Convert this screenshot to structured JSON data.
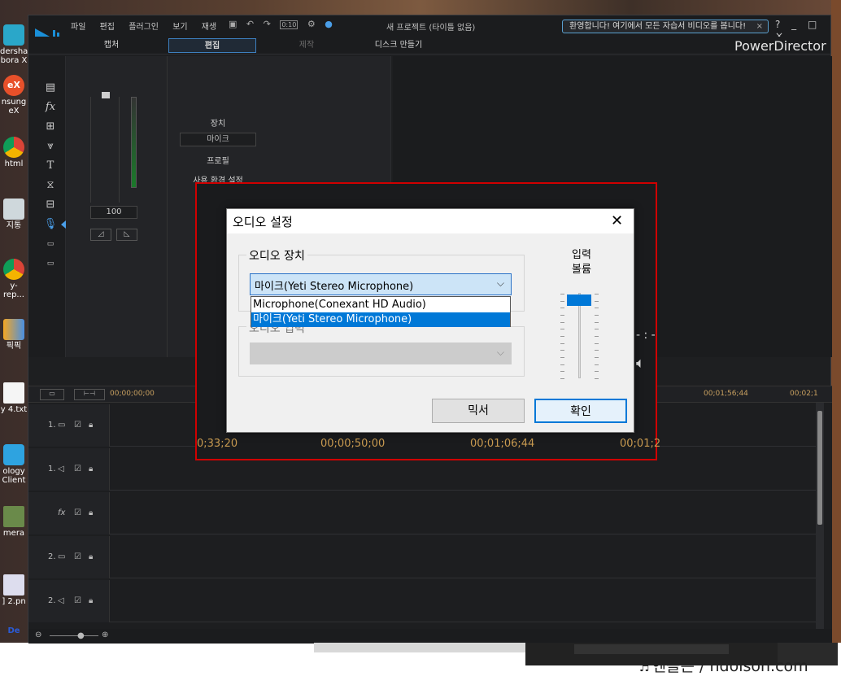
{
  "desktop": {
    "icons": [
      {
        "label": "dershare\nbora X"
      },
      {
        "label": "nsung\neX"
      },
      {
        "label": "html"
      },
      {
        "label": "지통"
      },
      {
        "label": "y-rep..."
      },
      {
        "label": "픽픽"
      },
      {
        "label": "y 4.txt"
      },
      {
        "label": "ology\nClient"
      },
      {
        "label": "mera"
      },
      {
        "label": "] 2.pn"
      },
      {
        "label": "De"
      }
    ],
    "badge_ex": "eX"
  },
  "app": {
    "menu": [
      "파일",
      "편집",
      "플러그인",
      "보기",
      "재생"
    ],
    "toolbar_time": "0:10",
    "window_title": "새 프로젝트 (타이틀 없음)",
    "welcome_text": "환영합니다! 여기에서 모든 자습서 비디오를 봅니다!",
    "welcome_close": "×",
    "window_controls": "? _ □ ×",
    "modes": [
      {
        "label": "캡처",
        "state": "normal"
      },
      {
        "label": "편집",
        "state": "active"
      },
      {
        "label": "제작",
        "state": "dim"
      },
      {
        "label": "디스크 만들기",
        "state": "normal"
      }
    ],
    "brand": "PowerDirector"
  },
  "panel": {
    "volume_value": "100",
    "device_label": "장치",
    "device_value": "마이크",
    "profile_label": "프로필",
    "settings_label": "사용 환경 설정"
  },
  "timeline": {
    "ruler_start": "00;00;00;00",
    "ruler_mid": "00;01;56;44",
    "ruler_end": "00;02;1",
    "tracks": [
      {
        "label": "1."
      },
      {
        "label": "1."
      },
      {
        "label": "fx"
      },
      {
        "label": "2."
      },
      {
        "label": "2."
      }
    ],
    "behind_times": [
      "0;33;20",
      "00;00;50;00",
      "00;01;06;44",
      "00;01;2"
    ],
    "behind_time_display": "- : -"
  },
  "dialog": {
    "title": "오디오 설정",
    "close": "✕",
    "device_group": "오디오 장치",
    "selected_device": "마이크(Yeti Stereo Microphone)",
    "options": [
      {
        "label": "Microphone(Conexant HD Audio)",
        "selected": false
      },
      {
        "label": "마이크(Yeti Stereo Microphone)",
        "selected": true
      }
    ],
    "input_group_partial": "오디오 입력",
    "input_volume_label_1": "입력",
    "input_volume_label_2": "볼륨",
    "input_volume_level": 0.95,
    "mixer_button": "믹서",
    "ok_button": "확인"
  },
  "credit": {
    "text": "엔돌슨 / ndolson.com"
  },
  "colors": {
    "highlight": "#d00000",
    "accent": "#0078d7",
    "app_bg": "#1e1f21"
  }
}
